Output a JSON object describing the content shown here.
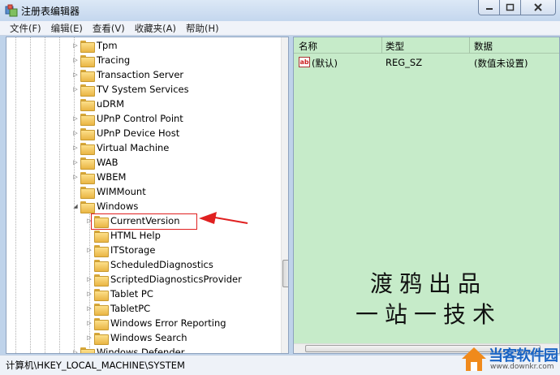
{
  "window": {
    "title": "注册表编辑器"
  },
  "menu": [
    "文件(F)",
    "编辑(E)",
    "查看(V)",
    "收藏夹(A)",
    "帮助(H)"
  ],
  "tree": {
    "items": [
      {
        "label": "Tpm",
        "level": 1,
        "expander": "▷"
      },
      {
        "label": "Tracing",
        "level": 1,
        "expander": "▷"
      },
      {
        "label": "Transaction Server",
        "level": 1,
        "expander": "▷"
      },
      {
        "label": "TV System Services",
        "level": 1,
        "expander": "▷"
      },
      {
        "label": "uDRM",
        "level": 1,
        "expander": ""
      },
      {
        "label": "UPnP Control Point",
        "level": 1,
        "expander": "▷"
      },
      {
        "label": "UPnP Device Host",
        "level": 1,
        "expander": "▷"
      },
      {
        "label": "Virtual Machine",
        "level": 1,
        "expander": "▷"
      },
      {
        "label": "WAB",
        "level": 1,
        "expander": "▷"
      },
      {
        "label": "WBEM",
        "level": 1,
        "expander": "▷"
      },
      {
        "label": "WIMMount",
        "level": 1,
        "expander": ""
      },
      {
        "label": "Windows",
        "level": 1,
        "expander": "◢"
      },
      {
        "label": "CurrentVersion",
        "level": 2,
        "expander": "▷"
      },
      {
        "label": "HTML Help",
        "level": 2,
        "expander": ""
      },
      {
        "label": "ITStorage",
        "level": 2,
        "expander": "▷"
      },
      {
        "label": "ScheduledDiagnostics",
        "level": 2,
        "expander": ""
      },
      {
        "label": "ScriptedDiagnosticsProvider",
        "level": 2,
        "expander": "▷"
      },
      {
        "label": "Tablet PC",
        "level": 2,
        "expander": "▷"
      },
      {
        "label": "TabletPC",
        "level": 2,
        "expander": "▷"
      },
      {
        "label": "Windows Error Reporting",
        "level": 2,
        "expander": "▷"
      },
      {
        "label": "Windows Search",
        "level": 2,
        "expander": "▷"
      },
      {
        "label": "Windows Defender",
        "level": 1,
        "expander": "▷"
      }
    ]
  },
  "list": {
    "columns": [
      "名称",
      "类型",
      "数据"
    ],
    "rows": [
      {
        "name": "(默认)",
        "type": "REG_SZ",
        "data": "(数值未设置)"
      }
    ],
    "calligraphy": [
      "渡鸦出品",
      "一站一技术"
    ]
  },
  "status": {
    "path": "计算机\\HKEY_LOCAL_MACHINE\\SYSTEM"
  },
  "watermark": {
    "brand": "当客软件园",
    "url": "www.downkr.com"
  },
  "colors": {
    "list_background": "#c6ebc9",
    "highlight": "#e02020",
    "brand": "#1a64c4"
  }
}
